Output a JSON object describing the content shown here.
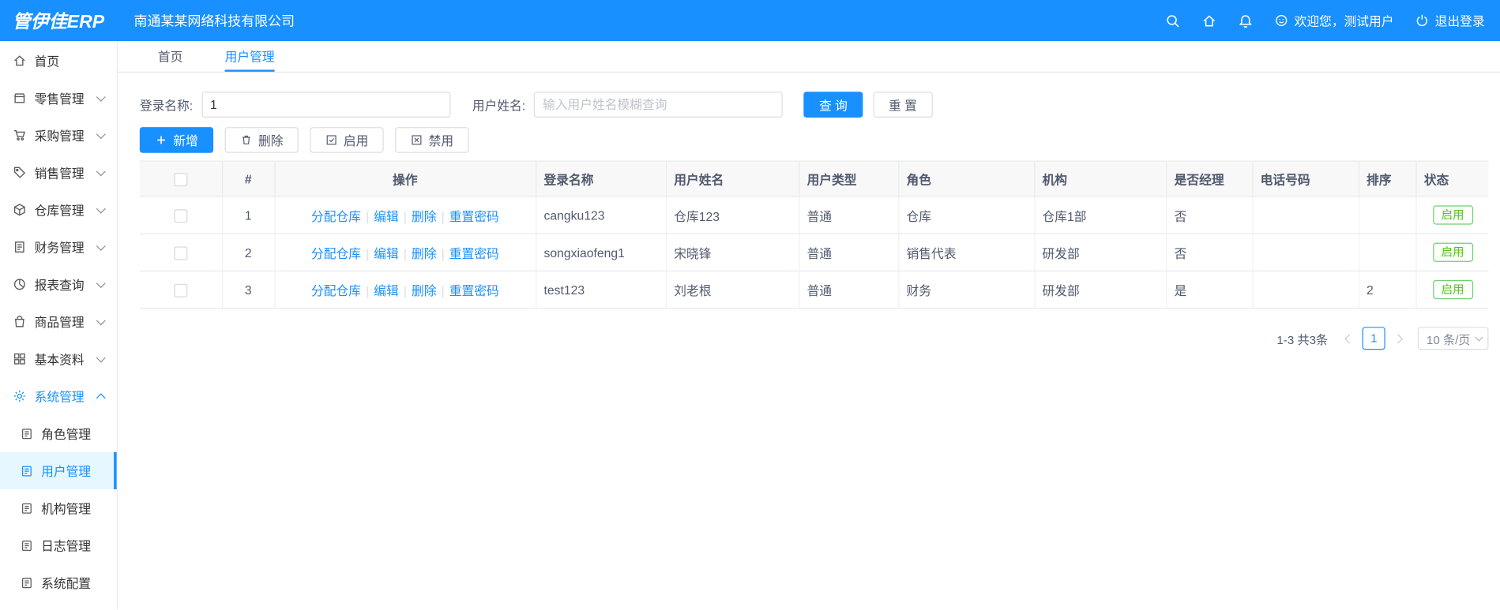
{
  "header": {
    "logo": "管伊佳ERP",
    "company": "南通某某网络科技有限公司",
    "welcome": "欢迎您，测试用户",
    "logout": "退出登录"
  },
  "sidebar": {
    "items": [
      {
        "label": "首页",
        "icon": "home-icon"
      },
      {
        "label": "零售管理",
        "icon": "retail-icon"
      },
      {
        "label": "采购管理",
        "icon": "purchase-icon"
      },
      {
        "label": "销售管理",
        "icon": "sales-icon"
      },
      {
        "label": "仓库管理",
        "icon": "warehouse-icon"
      },
      {
        "label": "财务管理",
        "icon": "finance-icon"
      },
      {
        "label": "报表查询",
        "icon": "report-icon"
      },
      {
        "label": "商品管理",
        "icon": "goods-icon"
      },
      {
        "label": "基本资料",
        "icon": "basic-data-icon"
      },
      {
        "label": "系统管理",
        "icon": "gear-icon"
      }
    ],
    "submenu": [
      {
        "label": "角色管理"
      },
      {
        "label": "用户管理"
      },
      {
        "label": "机构管理"
      },
      {
        "label": "日志管理"
      },
      {
        "label": "系统配置"
      }
    ]
  },
  "tabs": [
    {
      "label": "首页"
    },
    {
      "label": "用户管理"
    }
  ],
  "filters": {
    "login_label": "登录名称:",
    "login_value": "1",
    "name_label": "用户姓名:",
    "name_placeholder": "输入用户姓名模糊查询",
    "search_label": "查 询",
    "reset_label": "重 置"
  },
  "toolbar": {
    "add_label": "新增",
    "delete_label": "删除",
    "enable_label": "启用",
    "disable_label": "禁用"
  },
  "table": {
    "headers": [
      "#",
      "操作",
      "登录名称",
      "用户姓名",
      "用户类型",
      "角色",
      "机构",
      "是否经理",
      "电话号码",
      "排序",
      "状态"
    ],
    "action_links": [
      "分配仓库",
      "编辑",
      "删除",
      "重置密码"
    ],
    "action_separator": "|",
    "rows": [
      {
        "index": "1",
        "login": "cangku123",
        "name": "仓库123",
        "type": "普通",
        "role": "仓库",
        "org": "仓库1部",
        "manager": "否",
        "phone": "",
        "sort": "",
        "status": "启用"
      },
      {
        "index": "2",
        "login": "songxiaofeng1",
        "name": "宋晓锋",
        "type": "普通",
        "role": "销售代表",
        "org": "研发部",
        "manager": "否",
        "phone": "",
        "sort": "",
        "status": "启用"
      },
      {
        "index": "3",
        "login": "test123",
        "name": "刘老根",
        "type": "普通",
        "role": "财务",
        "org": "研发部",
        "manager": "是",
        "phone": "",
        "sort": "2",
        "status": "启用"
      }
    ]
  },
  "pagination": {
    "total": "1-3 共3条",
    "page": "1",
    "page_size": "10 条/页"
  }
}
